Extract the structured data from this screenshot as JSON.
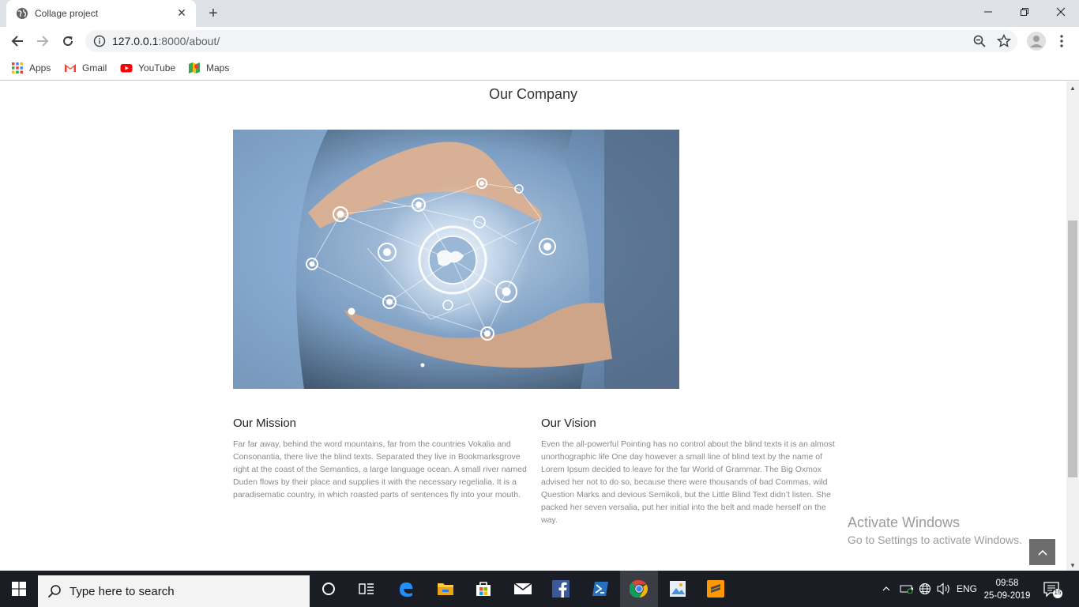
{
  "browser": {
    "tab_title": "Collage project",
    "url_host": "127.0.0.1",
    "url_path": ":8000/about/",
    "bookmarks": [
      "Apps",
      "Gmail",
      "YouTube",
      "Maps"
    ]
  },
  "page": {
    "title": "Our Company",
    "mission": {
      "heading": "Our Mission",
      "text": "Far far away, behind the word mountains, far from the countries Vokalia and Consonantia, there live the blind texts. Separated they live in Bookmarksgrove right at the coast of the Semantics, a large language ocean. A small river named Duden flows by their place and supplies it with the necessary regelialia. It is a paradisematic country, in which roasted parts of sentences fly into your mouth."
    },
    "vision": {
      "heading": "Our Vision",
      "text": "Even the all-powerful Pointing has no control about the blind texts it is an almost unorthographic life One day however a small line of blind text by the name of Lorem Ipsum decided to leave for the far World of Grammar. The Big Oxmox advised her not to do so, because there were thousands of bad Commas, wild Question Marks and devious Semikoli, but the Little Blind Text didn’t listen. She packed her seven versalia, put her initial into the belt and made herself on the way."
    }
  },
  "watermark": {
    "line1": "Activate Windows",
    "line2": "Go to Settings to activate Windows."
  },
  "taskbar": {
    "search_placeholder": "Type here to search",
    "language": "ENG",
    "time": "09:58",
    "date": "25-09-2019",
    "notification_count": "15"
  },
  "colors": {
    "tabstrip": "#dee1e6",
    "taskbar": "#1a1d23",
    "back_to_top": "#6d6d6d"
  }
}
